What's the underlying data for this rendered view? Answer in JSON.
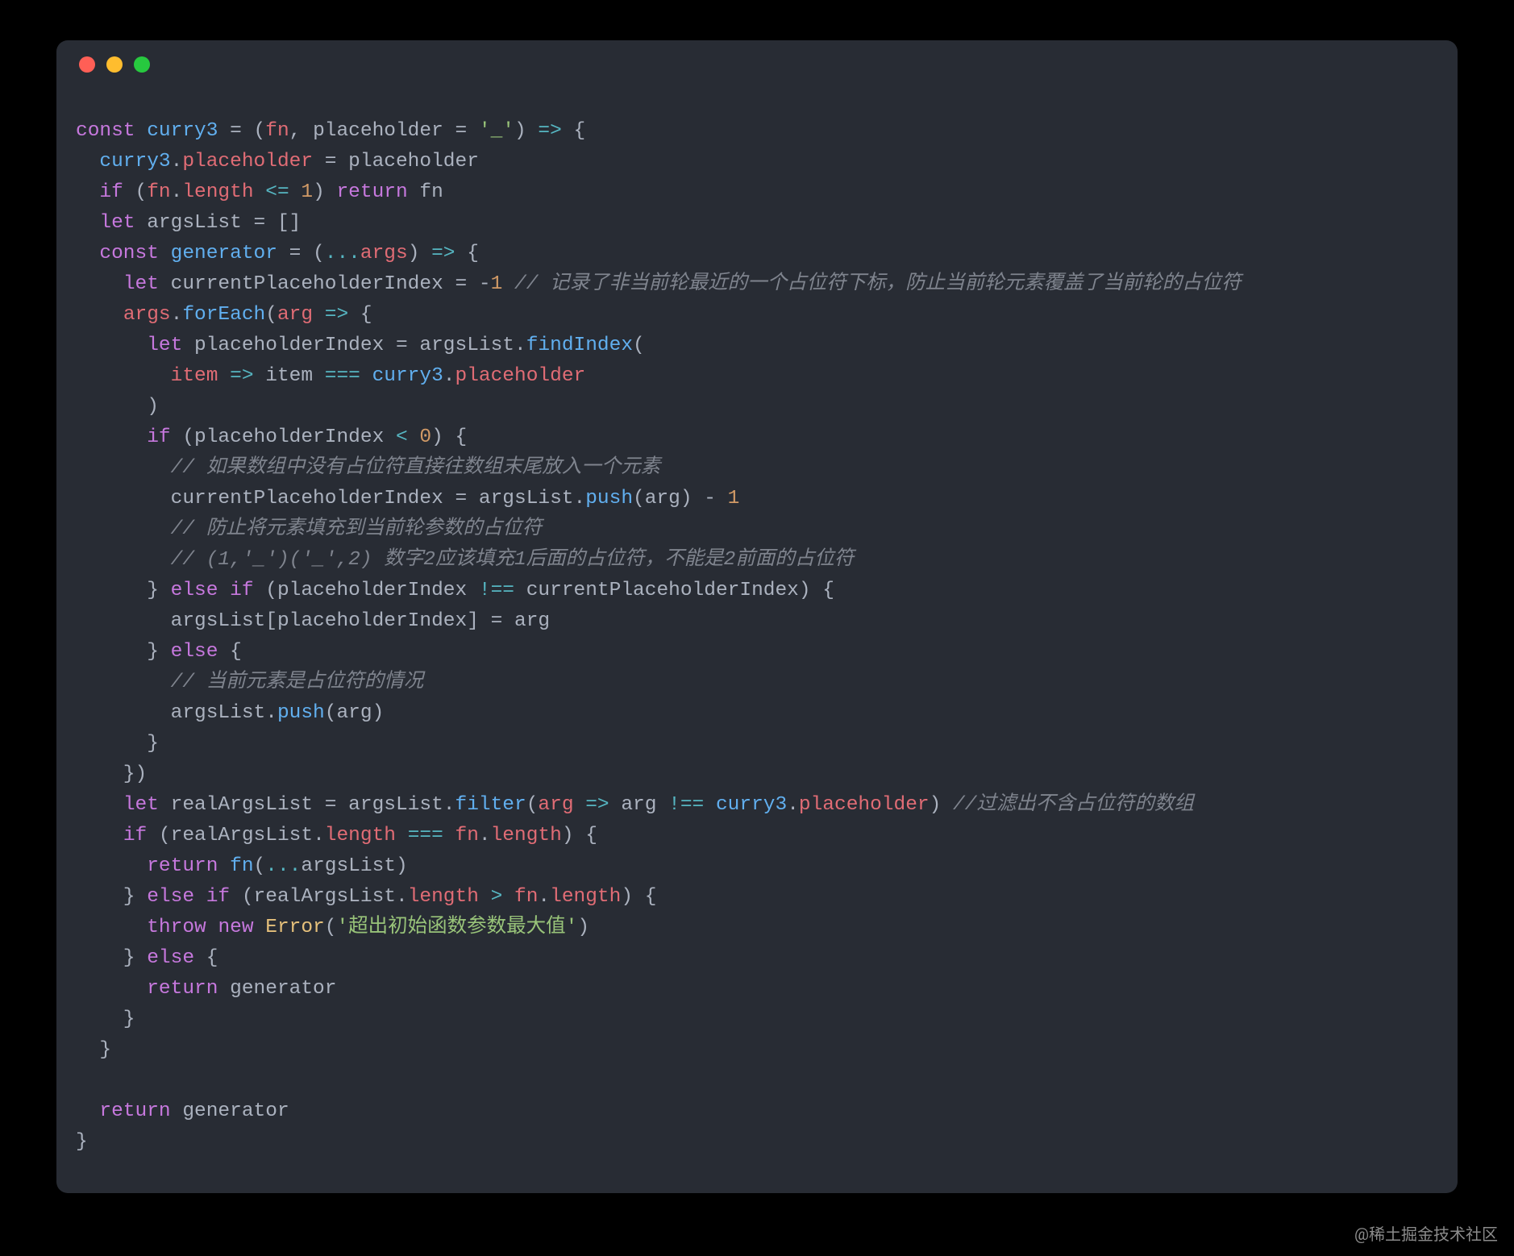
{
  "footer": "@稀土掘金技术社区",
  "lines": [
    [
      {
        "cls": "kw",
        "t": "const"
      },
      {
        "cls": "pun",
        "t": " "
      },
      {
        "cls": "fn",
        "t": "curry3"
      },
      {
        "cls": "pun",
        "t": " "
      },
      {
        "cls": "opg",
        "t": "="
      },
      {
        "cls": "pun",
        "t": " ("
      },
      {
        "cls": "prop",
        "t": "fn"
      },
      {
        "cls": "pun",
        "t": ", "
      },
      {
        "cls": "name",
        "t": "placeholder "
      },
      {
        "cls": "opg",
        "t": "="
      },
      {
        "cls": "pun",
        "t": " "
      },
      {
        "cls": "str",
        "t": "'_'"
      },
      {
        "cls": "pun",
        "t": ") "
      },
      {
        "cls": "op",
        "t": "=>"
      },
      {
        "cls": "pun",
        "t": " {"
      }
    ],
    [
      {
        "cls": "pun",
        "t": "  "
      },
      {
        "cls": "fn",
        "t": "curry3"
      },
      {
        "cls": "pun",
        "t": "."
      },
      {
        "cls": "prop",
        "t": "placeholder"
      },
      {
        "cls": "pun",
        "t": " "
      },
      {
        "cls": "opg",
        "t": "="
      },
      {
        "cls": "pun",
        "t": " "
      },
      {
        "cls": "name",
        "t": "placeholder"
      }
    ],
    [
      {
        "cls": "pun",
        "t": "  "
      },
      {
        "cls": "kw",
        "t": "if"
      },
      {
        "cls": "pun",
        "t": " ("
      },
      {
        "cls": "prop",
        "t": "fn"
      },
      {
        "cls": "pun",
        "t": "."
      },
      {
        "cls": "prop",
        "t": "length"
      },
      {
        "cls": "pun",
        "t": " "
      },
      {
        "cls": "op",
        "t": "<="
      },
      {
        "cls": "pun",
        "t": " "
      },
      {
        "cls": "num",
        "t": "1"
      },
      {
        "cls": "pun",
        "t": ") "
      },
      {
        "cls": "kw",
        "t": "return"
      },
      {
        "cls": "pun",
        "t": " "
      },
      {
        "cls": "name",
        "t": "fn"
      }
    ],
    [
      {
        "cls": "pun",
        "t": "  "
      },
      {
        "cls": "kw",
        "t": "let"
      },
      {
        "cls": "pun",
        "t": " "
      },
      {
        "cls": "name",
        "t": "argsList "
      },
      {
        "cls": "opg",
        "t": "="
      },
      {
        "cls": "pun",
        "t": " []"
      }
    ],
    [
      {
        "cls": "pun",
        "t": "  "
      },
      {
        "cls": "kw",
        "t": "const"
      },
      {
        "cls": "pun",
        "t": " "
      },
      {
        "cls": "fn",
        "t": "generator"
      },
      {
        "cls": "pun",
        "t": " "
      },
      {
        "cls": "opg",
        "t": "="
      },
      {
        "cls": "pun",
        "t": " ("
      },
      {
        "cls": "op",
        "t": "..."
      },
      {
        "cls": "prop",
        "t": "args"
      },
      {
        "cls": "pun",
        "t": ") "
      },
      {
        "cls": "op",
        "t": "=>"
      },
      {
        "cls": "pun",
        "t": " {"
      }
    ],
    [
      {
        "cls": "pun",
        "t": "    "
      },
      {
        "cls": "kw",
        "t": "let"
      },
      {
        "cls": "pun",
        "t": " "
      },
      {
        "cls": "name",
        "t": "currentPlaceholderIndex "
      },
      {
        "cls": "opg",
        "t": "="
      },
      {
        "cls": "pun",
        "t": " "
      },
      {
        "cls": "opg",
        "t": "-"
      },
      {
        "cls": "num",
        "t": "1"
      },
      {
        "cls": "pun",
        "t": " "
      },
      {
        "cls": "cmt",
        "t": "// 记录了非当前轮最近的一个占位符下标，防止当前轮元素覆盖了当前轮的占位符"
      }
    ],
    [
      {
        "cls": "pun",
        "t": "    "
      },
      {
        "cls": "prop",
        "t": "args"
      },
      {
        "cls": "pun",
        "t": "."
      },
      {
        "cls": "fn",
        "t": "forEach"
      },
      {
        "cls": "pun",
        "t": "("
      },
      {
        "cls": "prop",
        "t": "arg"
      },
      {
        "cls": "pun",
        "t": " "
      },
      {
        "cls": "op",
        "t": "=>"
      },
      {
        "cls": "pun",
        "t": " {"
      }
    ],
    [
      {
        "cls": "pun",
        "t": "      "
      },
      {
        "cls": "kw",
        "t": "let"
      },
      {
        "cls": "pun",
        "t": " "
      },
      {
        "cls": "name",
        "t": "placeholderIndex "
      },
      {
        "cls": "opg",
        "t": "="
      },
      {
        "cls": "pun",
        "t": " "
      },
      {
        "cls": "name",
        "t": "argsList"
      },
      {
        "cls": "pun",
        "t": "."
      },
      {
        "cls": "fn",
        "t": "findIndex"
      },
      {
        "cls": "pun",
        "t": "("
      }
    ],
    [
      {
        "cls": "pun",
        "t": "        "
      },
      {
        "cls": "prop",
        "t": "item"
      },
      {
        "cls": "pun",
        "t": " "
      },
      {
        "cls": "op",
        "t": "=>"
      },
      {
        "cls": "pun",
        "t": " "
      },
      {
        "cls": "name",
        "t": "item "
      },
      {
        "cls": "op",
        "t": "==="
      },
      {
        "cls": "pun",
        "t": " "
      },
      {
        "cls": "fn",
        "t": "curry3"
      },
      {
        "cls": "pun",
        "t": "."
      },
      {
        "cls": "prop",
        "t": "placeholder"
      }
    ],
    [
      {
        "cls": "pun",
        "t": "      )"
      }
    ],
    [
      {
        "cls": "pun",
        "t": "      "
      },
      {
        "cls": "kw",
        "t": "if"
      },
      {
        "cls": "pun",
        "t": " ("
      },
      {
        "cls": "name",
        "t": "placeholderIndex "
      },
      {
        "cls": "op",
        "t": "<"
      },
      {
        "cls": "pun",
        "t": " "
      },
      {
        "cls": "num",
        "t": "0"
      },
      {
        "cls": "pun",
        "t": ") {"
      }
    ],
    [
      {
        "cls": "pun",
        "t": "        "
      },
      {
        "cls": "cmt",
        "t": "// 如果数组中没有占位符直接往数组末尾放入一个元素"
      }
    ],
    [
      {
        "cls": "pun",
        "t": "        "
      },
      {
        "cls": "name",
        "t": "currentPlaceholderIndex "
      },
      {
        "cls": "opg",
        "t": "="
      },
      {
        "cls": "pun",
        "t": " "
      },
      {
        "cls": "name",
        "t": "argsList"
      },
      {
        "cls": "pun",
        "t": "."
      },
      {
        "cls": "fn",
        "t": "push"
      },
      {
        "cls": "pun",
        "t": "("
      },
      {
        "cls": "name",
        "t": "arg"
      },
      {
        "cls": "pun",
        "t": ") "
      },
      {
        "cls": "opg",
        "t": "-"
      },
      {
        "cls": "pun",
        "t": " "
      },
      {
        "cls": "num",
        "t": "1"
      }
    ],
    [
      {
        "cls": "pun",
        "t": "        "
      },
      {
        "cls": "cmt",
        "t": "// 防止将元素填充到当前轮参数的占位符"
      }
    ],
    [
      {
        "cls": "pun",
        "t": "        "
      },
      {
        "cls": "cmt",
        "t": "// (1,'_')('_',2) 数字2应该填充1后面的占位符，不能是2前面的占位符"
      }
    ],
    [
      {
        "cls": "pun",
        "t": "      } "
      },
      {
        "cls": "kw",
        "t": "else"
      },
      {
        "cls": "pun",
        "t": " "
      },
      {
        "cls": "kw",
        "t": "if"
      },
      {
        "cls": "pun",
        "t": " ("
      },
      {
        "cls": "name",
        "t": "placeholderIndex "
      },
      {
        "cls": "op",
        "t": "!=="
      },
      {
        "cls": "pun",
        "t": " "
      },
      {
        "cls": "name",
        "t": "currentPlaceholderIndex"
      },
      {
        "cls": "pun",
        "t": ") {"
      }
    ],
    [
      {
        "cls": "pun",
        "t": "        "
      },
      {
        "cls": "name",
        "t": "argsList"
      },
      {
        "cls": "pun",
        "t": "["
      },
      {
        "cls": "name",
        "t": "placeholderIndex"
      },
      {
        "cls": "pun",
        "t": "] "
      },
      {
        "cls": "opg",
        "t": "="
      },
      {
        "cls": "pun",
        "t": " "
      },
      {
        "cls": "name",
        "t": "arg"
      }
    ],
    [
      {
        "cls": "pun",
        "t": "      } "
      },
      {
        "cls": "kw",
        "t": "else"
      },
      {
        "cls": "pun",
        "t": " {"
      }
    ],
    [
      {
        "cls": "pun",
        "t": "        "
      },
      {
        "cls": "cmt",
        "t": "// 当前元素是占位符的情况"
      }
    ],
    [
      {
        "cls": "pun",
        "t": "        "
      },
      {
        "cls": "name",
        "t": "argsList"
      },
      {
        "cls": "pun",
        "t": "."
      },
      {
        "cls": "fn",
        "t": "push"
      },
      {
        "cls": "pun",
        "t": "("
      },
      {
        "cls": "name",
        "t": "arg"
      },
      {
        "cls": "pun",
        "t": ")"
      }
    ],
    [
      {
        "cls": "pun",
        "t": "      }"
      }
    ],
    [
      {
        "cls": "pun",
        "t": "    })"
      }
    ],
    [
      {
        "cls": "pun",
        "t": "    "
      },
      {
        "cls": "kw",
        "t": "let"
      },
      {
        "cls": "pun",
        "t": " "
      },
      {
        "cls": "name",
        "t": "realArgsList "
      },
      {
        "cls": "opg",
        "t": "="
      },
      {
        "cls": "pun",
        "t": " "
      },
      {
        "cls": "name",
        "t": "argsList"
      },
      {
        "cls": "pun",
        "t": "."
      },
      {
        "cls": "fn",
        "t": "filter"
      },
      {
        "cls": "pun",
        "t": "("
      },
      {
        "cls": "prop",
        "t": "arg"
      },
      {
        "cls": "pun",
        "t": " "
      },
      {
        "cls": "op",
        "t": "=>"
      },
      {
        "cls": "pun",
        "t": " "
      },
      {
        "cls": "name",
        "t": "arg "
      },
      {
        "cls": "op",
        "t": "!=="
      },
      {
        "cls": "pun",
        "t": " "
      },
      {
        "cls": "fn",
        "t": "curry3"
      },
      {
        "cls": "pun",
        "t": "."
      },
      {
        "cls": "prop",
        "t": "placeholder"
      },
      {
        "cls": "pun",
        "t": ") "
      },
      {
        "cls": "cmt",
        "t": "//过滤出不含占位符的数组"
      }
    ],
    [
      {
        "cls": "pun",
        "t": "    "
      },
      {
        "cls": "kw",
        "t": "if"
      },
      {
        "cls": "pun",
        "t": " ("
      },
      {
        "cls": "name",
        "t": "realArgsList"
      },
      {
        "cls": "pun",
        "t": "."
      },
      {
        "cls": "prop",
        "t": "length"
      },
      {
        "cls": "pun",
        "t": " "
      },
      {
        "cls": "op",
        "t": "==="
      },
      {
        "cls": "pun",
        "t": " "
      },
      {
        "cls": "prop",
        "t": "fn"
      },
      {
        "cls": "pun",
        "t": "."
      },
      {
        "cls": "prop",
        "t": "length"
      },
      {
        "cls": "pun",
        "t": ") {"
      }
    ],
    [
      {
        "cls": "pun",
        "t": "      "
      },
      {
        "cls": "kw",
        "t": "return"
      },
      {
        "cls": "pun",
        "t": " "
      },
      {
        "cls": "fn",
        "t": "fn"
      },
      {
        "cls": "pun",
        "t": "("
      },
      {
        "cls": "op",
        "t": "..."
      },
      {
        "cls": "name",
        "t": "argsList"
      },
      {
        "cls": "pun",
        "t": ")"
      }
    ],
    [
      {
        "cls": "pun",
        "t": "    } "
      },
      {
        "cls": "kw",
        "t": "else"
      },
      {
        "cls": "pun",
        "t": " "
      },
      {
        "cls": "kw",
        "t": "if"
      },
      {
        "cls": "pun",
        "t": " ("
      },
      {
        "cls": "name",
        "t": "realArgsList"
      },
      {
        "cls": "pun",
        "t": "."
      },
      {
        "cls": "prop",
        "t": "length"
      },
      {
        "cls": "pun",
        "t": " "
      },
      {
        "cls": "op",
        "t": ">"
      },
      {
        "cls": "pun",
        "t": " "
      },
      {
        "cls": "prop",
        "t": "fn"
      },
      {
        "cls": "pun",
        "t": "."
      },
      {
        "cls": "prop",
        "t": "length"
      },
      {
        "cls": "pun",
        "t": ") {"
      }
    ],
    [
      {
        "cls": "pun",
        "t": "      "
      },
      {
        "cls": "kw",
        "t": "throw"
      },
      {
        "cls": "pun",
        "t": " "
      },
      {
        "cls": "kw",
        "t": "new"
      },
      {
        "cls": "pun",
        "t": " "
      },
      {
        "cls": "cls",
        "t": "Error"
      },
      {
        "cls": "pun",
        "t": "("
      },
      {
        "cls": "str",
        "t": "'超出初始函数参数最大值'"
      },
      {
        "cls": "pun",
        "t": ")"
      }
    ],
    [
      {
        "cls": "pun",
        "t": "    } "
      },
      {
        "cls": "kw",
        "t": "else"
      },
      {
        "cls": "pun",
        "t": " {"
      }
    ],
    [
      {
        "cls": "pun",
        "t": "      "
      },
      {
        "cls": "kw",
        "t": "return"
      },
      {
        "cls": "pun",
        "t": " "
      },
      {
        "cls": "name",
        "t": "generator"
      }
    ],
    [
      {
        "cls": "pun",
        "t": "    }"
      }
    ],
    [
      {
        "cls": "pun",
        "t": "  }"
      }
    ],
    [
      {
        "cls": "pun",
        "t": ""
      }
    ],
    [
      {
        "cls": "pun",
        "t": "  "
      },
      {
        "cls": "kw",
        "t": "return"
      },
      {
        "cls": "pun",
        "t": " "
      },
      {
        "cls": "name",
        "t": "generator"
      }
    ],
    [
      {
        "cls": "pun",
        "t": "}"
      }
    ]
  ]
}
